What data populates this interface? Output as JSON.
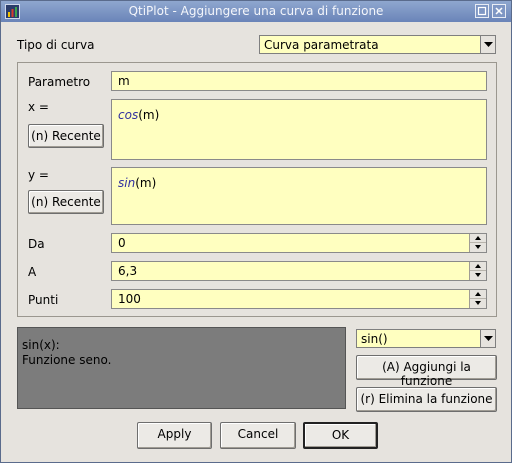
{
  "window": {
    "title": "QtiPlot - Aggiungere una curva di funzione"
  },
  "curve_type": {
    "label": "Tipo di curva",
    "selected": "Curva parametrata"
  },
  "param": {
    "label": "Parametro",
    "value": "m"
  },
  "x": {
    "label": "x =",
    "fn": "cos",
    "arg": "(m)",
    "recent_label": "(n) Recente"
  },
  "y": {
    "label": "y =",
    "fn": "sin",
    "arg": "(m)",
    "recent_label": "(n) Recente"
  },
  "from": {
    "label": "Da",
    "value": "0"
  },
  "to": {
    "label": "A",
    "value": "6,3"
  },
  "points": {
    "label": "Punti",
    "value": "100"
  },
  "help": {
    "line1": "sin(x):",
    "line2": "Funzione seno."
  },
  "function_select": {
    "selected": "sin()"
  },
  "buttons": {
    "add_function": "(A) Aggiungi la funzione",
    "remove_function": "(r) Elimina la funzione",
    "apply": "Apply",
    "cancel": "Cancel",
    "ok": "OK"
  },
  "colors": {
    "input_bg": "#ffffc0",
    "titlebar": "#7a93c2",
    "help_bg": "#7c7c7c",
    "function_name": "#3030a0"
  }
}
